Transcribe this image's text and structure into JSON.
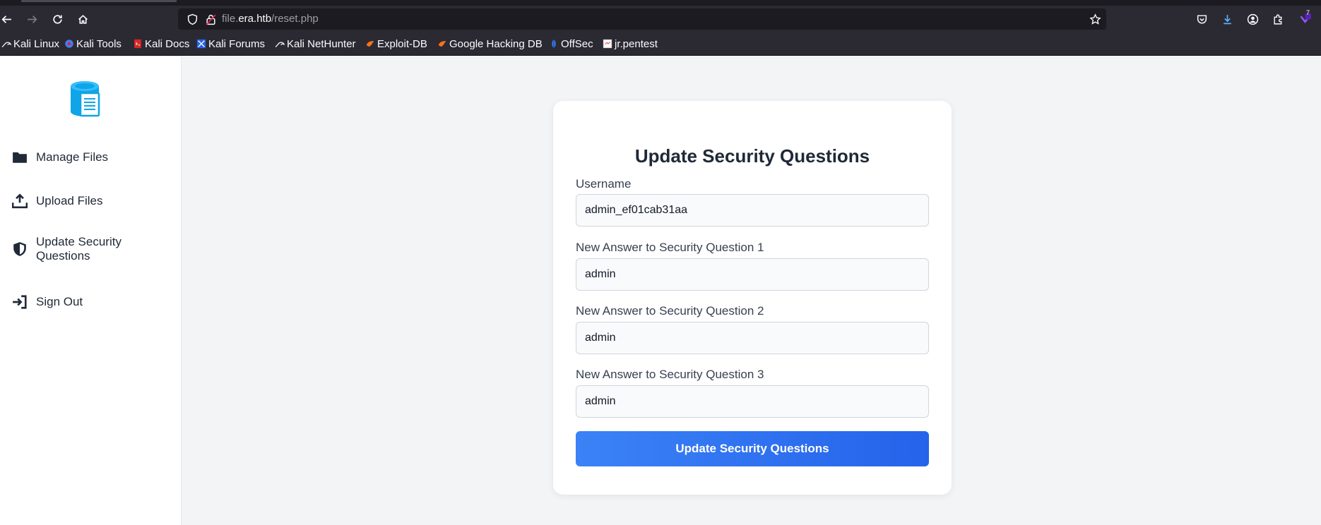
{
  "browser": {
    "url_host_prefix": "file.",
    "url_host": "era.htb",
    "url_path": "/reset.php",
    "download_badge": "7",
    "bookmarks": [
      {
        "label": "Kali Linux",
        "icon": "kali-dragon-icon"
      },
      {
        "label": "Kali Tools",
        "icon": "kali-tools-icon"
      },
      {
        "label": "Kali Docs",
        "icon": "kali-docs-icon"
      },
      {
        "label": "Kali Forums",
        "icon": "kali-forums-icon"
      },
      {
        "label": "Kali NetHunter",
        "icon": "kali-dragon-icon"
      },
      {
        "label": "Exploit-DB",
        "icon": "exploit-db-icon"
      },
      {
        "label": "Google Hacking DB",
        "icon": "exploit-db-icon"
      },
      {
        "label": "OffSec",
        "icon": "offsec-icon"
      },
      {
        "label": "jr.pentest",
        "icon": "page-icon"
      }
    ]
  },
  "sidebar": {
    "items": [
      {
        "label": "Manage Files",
        "icon": "folder-icon"
      },
      {
        "label": "Upload Files",
        "icon": "upload-icon"
      },
      {
        "label": "Update Security\nQuestions",
        "icon": "shield-icon"
      },
      {
        "label": "Sign Out",
        "icon": "sign-in-arrow-icon"
      }
    ]
  },
  "form": {
    "title": "Update Security Questions",
    "username_label": "Username",
    "username_value": "admin_ef01cab31aa",
    "q1_label": "New Answer to Security Question 1",
    "q1_value": "admin",
    "q2_label": "New Answer to Security Question 2",
    "q2_value": "admin",
    "q3_label": "New Answer to Security Question 3",
    "q3_value": "admin",
    "submit_label": "Update Security Questions"
  },
  "colors": {
    "accent": "#2563eb",
    "logo": "#0ea5e9",
    "page_bg": "#f3f4f6"
  }
}
